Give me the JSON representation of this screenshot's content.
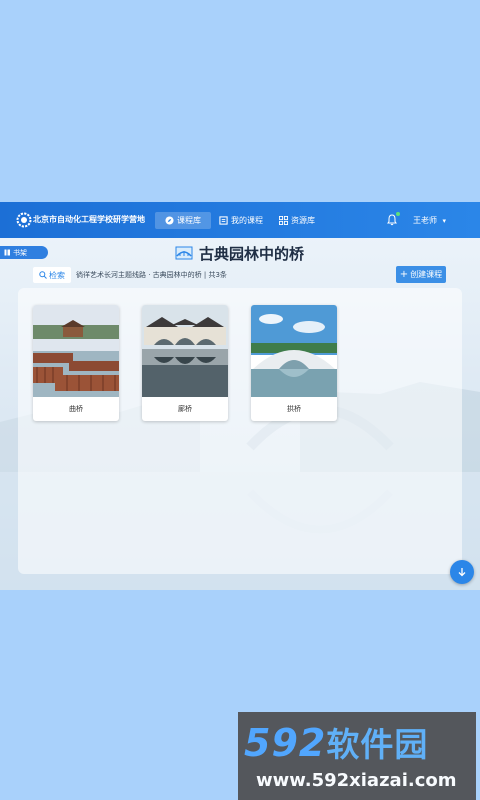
{
  "header": {
    "school_name": "北京市自动化工程学校研学营地",
    "nav": [
      {
        "label": "课程库",
        "active": true
      },
      {
        "label": "我的课程",
        "active": false
      },
      {
        "label": "资源库",
        "active": false
      }
    ],
    "user_name": "王老师",
    "user_caret": "▾",
    "accent_color": "#1c6fd6"
  },
  "sidebar": {
    "bookshelf_label": "书架"
  },
  "page": {
    "title": "古典园林中的桥",
    "search_label": "检索",
    "breadcrumb": "徜徉艺术长河主题线路 · 古典园林中的桥 | 共3条",
    "create_label": "创建课程"
  },
  "courses": [
    {
      "label": "曲桥"
    },
    {
      "label": "廊桥"
    },
    {
      "label": "拱桥"
    }
  ],
  "watermark": {
    "brand_number": "592",
    "brand_text": "软件园",
    "url": "www.592xiazai.com"
  }
}
